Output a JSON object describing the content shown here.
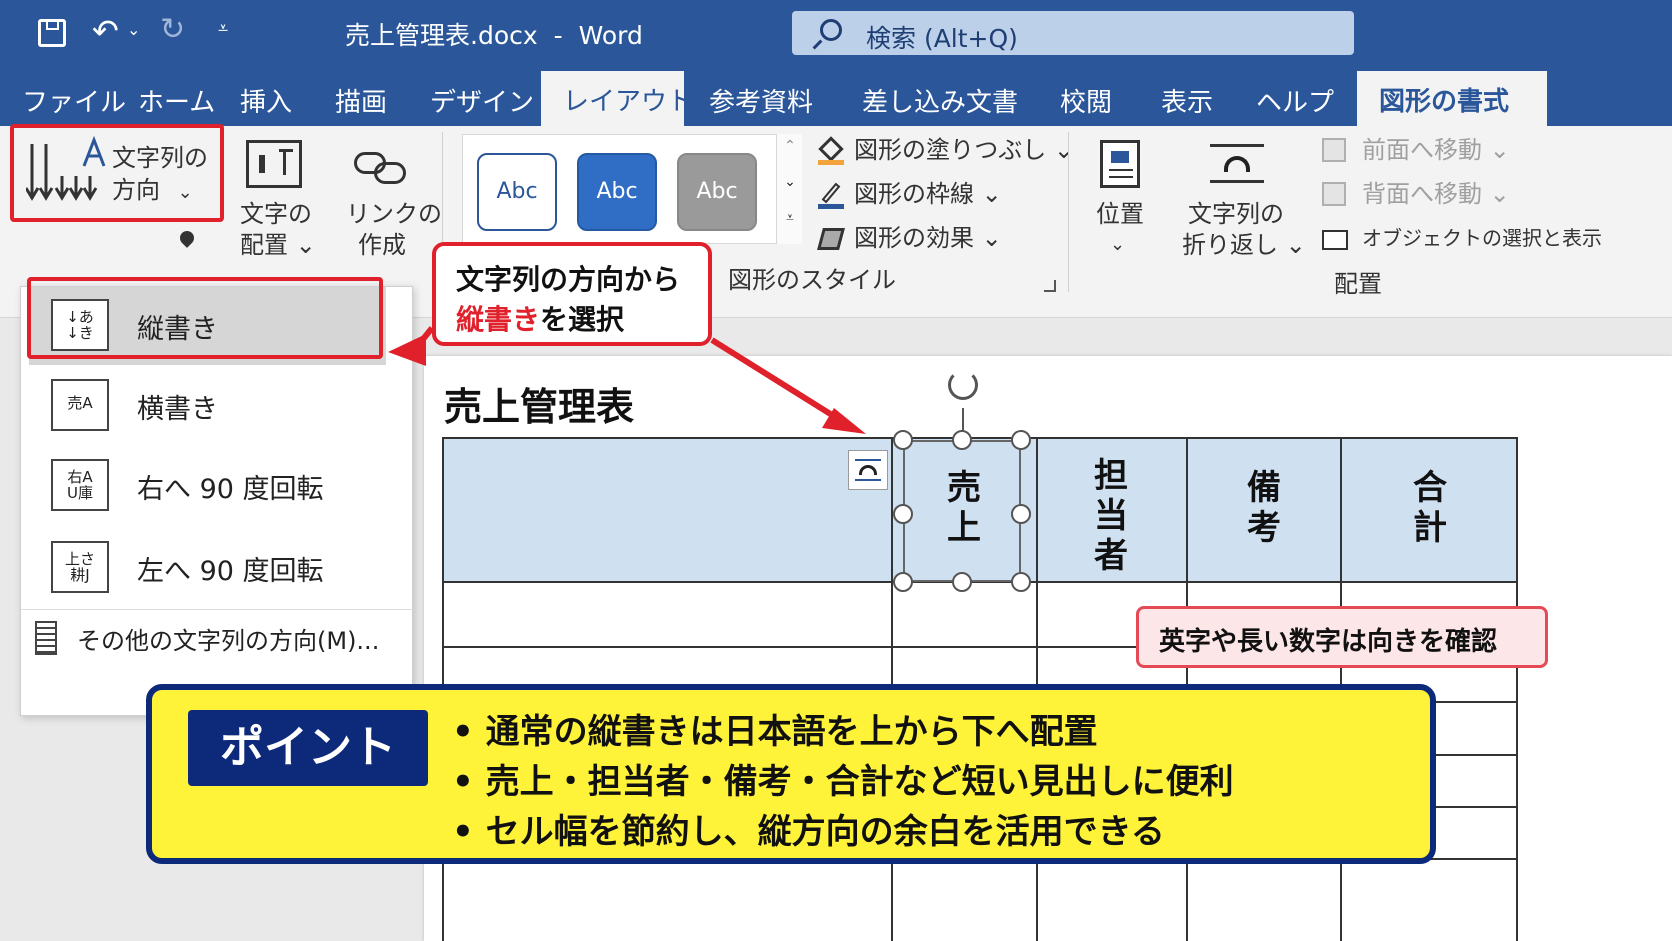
{
  "window": {
    "doc_title": "売上管理表.docx",
    "separator": "-",
    "app": "Word",
    "search_placeholder": "検索 (Alt+Q)"
  },
  "tabs": [
    "ファイル",
    "ホーム",
    "挿入",
    "描画",
    "デザイン",
    "レイアウト",
    "参考資料",
    "差し込み文書",
    "校閲",
    "表示",
    "ヘルプ",
    "図形の書式"
  ],
  "ribbon": {
    "text_direction": {
      "line1": "文字列の",
      "line2": "方向",
      "caret": "⌄"
    },
    "text_align": {
      "line1": "文字の",
      "line2": "配置 ⌄"
    },
    "link": {
      "line1": "リンクの",
      "line2": "作成"
    },
    "styles": [
      "Abc",
      "Abc",
      "Abc"
    ],
    "fill": "図形の塗りつぶし ⌄",
    "outline": "図形の枠線 ⌄",
    "effects": "図形の効果 ⌄",
    "styles_group": "図形のスタイル",
    "position": {
      "line1": "位置",
      "line2": "⌄"
    },
    "wrap": {
      "line1": "文字列の",
      "line2": "折り返し ⌄"
    },
    "bring_forward": "前面へ移動 ⌄",
    "send_backward": "背面へ移動 ⌄",
    "selection_pane": "オブジェクトの選択と表示",
    "arrange_group": "配置"
  },
  "menu": {
    "items": [
      {
        "label": "縦書き",
        "icon": "vertical-text-icon"
      },
      {
        "label": "横書き",
        "icon": "horizontal-text-icon"
      },
      {
        "label": "右へ 90 度回転",
        "icon": "rotate-right-icon"
      },
      {
        "label": "左へ 90 度回転",
        "icon": "rotate-left-icon"
      }
    ],
    "more": "その他の文字列の方向(M)..."
  },
  "callout": {
    "line1": "文字列の方向から",
    "line2_red": "縦書き",
    "line2_rest": "を選択"
  },
  "document": {
    "title": "売上管理表",
    "headers": [
      "売上",
      "担当者",
      "備考",
      "合計"
    ]
  },
  "note": "英字や長い数字は向きを確認",
  "point": {
    "badge": "ポイント",
    "bullets": [
      "• 通常の縦書きは日本語を上から下へ配置",
      "• 売上・担当者・備考・合計など短い見出しに便利",
      "• セル幅を節約し、縦方向の余白を活用できる"
    ]
  },
  "colors": {
    "word_blue": "#2b579a",
    "accent_red": "#e0202a",
    "header_fill": "#cfe0f1",
    "point_yellow": "#fff33a",
    "point_navy": "#0d2a7a"
  }
}
